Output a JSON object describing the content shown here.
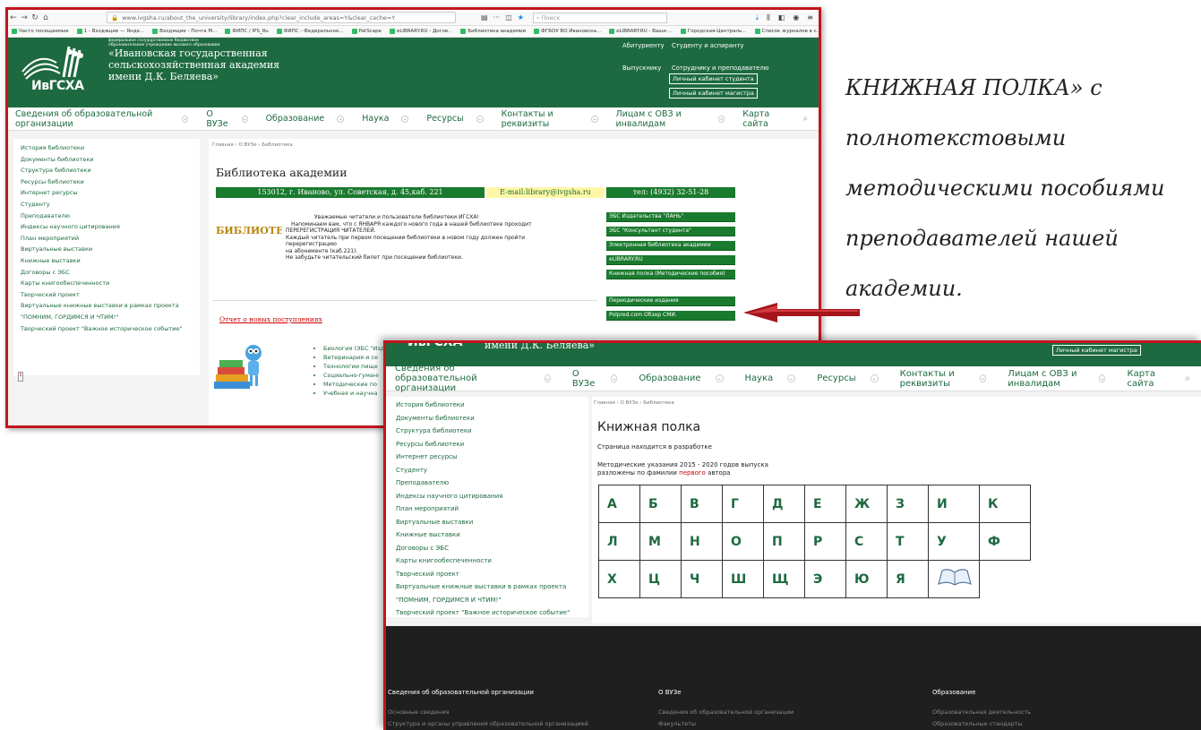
{
  "annotation": {
    "lines": [
      "КНИЖНАЯ ПОЛКА» с",
      "полнотекстовыми",
      "методическими пособиями",
      "преподавателей нашей",
      "академии."
    ]
  },
  "browser": {
    "url": "www.ivgsha.ru/about_the_university/library/index.php?clear_include_areas=Y&clear_cache=Y",
    "search_placeholder": "Поиск",
    "bookmarks": [
      "Часто посещаемые",
      "1 - Входящие — Янде...",
      "Входящие - Почта М...",
      "ФИПС / IPS_Ru",
      "ФИПС - Федеральное...",
      "PatScape",
      "eLIBRARY.RU - Догов...",
      "Библиотека академии",
      "ФГБОУ ВО Ивановска...",
      "eLIBRARY.RU - Ваши ...",
      "Городская-Централь...",
      "Список журналов в с..."
    ]
  },
  "site": {
    "logo_text": "ИвГСХА",
    "inst_small1": "федеральное государственное бюджетное",
    "inst_small2": "образовательное учреждение высшего образования",
    "inst_line1": "«Ивановская государственная",
    "inst_line2": "сельскохозяйственная академия",
    "inst_line3": "имени Д.К. Беляева»",
    "header_links": [
      "Абитуриенту",
      "Студенту и аспиранту",
      "Выпускнику",
      "Сотруднику и преподавателю"
    ],
    "cabinet_student": "Личный кабинет студента",
    "cabinet_master": "Личный кабинет магистра",
    "menu": [
      "Сведения об образовательной организации",
      "О ВУЗе",
      "Образование",
      "Наука",
      "Ресурсы",
      "Контакты и реквизиты",
      "Лицам с ОВЗ и инвалидам",
      "Карта сайта"
    ],
    "sidebar": [
      "История библиотеки",
      "Документы библиотеки",
      "Структура библиотеки",
      "Ресурсы библиотеки",
      "Интернет ресурсы",
      "Студенту",
      "Преподавателю",
      "Индексы научного цитирования",
      "План мероприятий",
      "Виртуальные выставки",
      "Книжные выставки",
      "Договоры с ЭБС",
      "Карты книгообеспеченности",
      "Творческий проект",
      "Виртуальные книжные выставки в рамках проекта \"ПОМНИМ, ГОРДИМСЯ И ЧТИМ!\"",
      "Творческий проект \"Важное историческое событие\""
    ]
  },
  "page1": {
    "breadcrumb": [
      "Главная",
      "О ВУЗе",
      "Библиотека"
    ],
    "title": "Библиотека академии",
    "address": "153012, г. Иваново, ул. Советская, д. 45,каб. 221",
    "email": "E-mail:library@ivgsha.ru",
    "phone": "тел: (4932) 32-51-28",
    "notice_line1": "Уважаемые читатели и пользователи библиотеки ИГСХА!",
    "notice_line2": "Напоминаем вам, что с ЯНВАРЯ каждого нового года в нашей библиотеке проходит",
    "notice_line3": "ПЕРЕРЕГИСТРАЦИЯ ЧИТАТЕЛЕЙ.",
    "notice_line4": "Каждый читатель при первом посещении библиотеки в новом году должен пройти перерегистрацию",
    "notice_line5": "на абонементе (каб.221).",
    "notice_line6": "Не забудьте читательский билет при посещении библиотеки.",
    "right_links": [
      "ЭБС Издательства \"ЛАНЬ\"",
      "ЭБС \"Консультант студента\"",
      "Электронная библиотека академии",
      "eLIBRARY.RU",
      "Книжная полка (Методические пособия)",
      "Периодические издания",
      "Polpred.com Обзор СМИ."
    ],
    "report_link": "Отчет о новых поступлениях",
    "books": [
      "Биология (ЭБС \"Издательство Лань\")",
      "Ветеринария и се",
      "Технологии пище",
      "Социально-гумані",
      "Методические по",
      "Учебная и научна"
    ]
  },
  "page2": {
    "breadcrumb": [
      "Главная",
      "О ВУЗе",
      "Библиотека"
    ],
    "title": "Книжная полка",
    "status": "Страница находится в разработке",
    "desc_line1": "Методические указания 2015 - 2020 годов выпуска",
    "desc_prefix": "разложены по фамилии ",
    "desc_highlight": "первого",
    "desc_suffix": " автора",
    "letters_row1": [
      "А",
      "Б",
      "В",
      "Г",
      "Д",
      "Е",
      "Ж",
      "З",
      "И",
      "К"
    ],
    "letters_row2": [
      "Л",
      "М",
      "Н",
      "О",
      "П",
      "Р",
      "С",
      "Т",
      "У",
      "Ф"
    ],
    "letters_row3": [
      "Х",
      "Ц",
      "Ч",
      "Ш",
      "Щ",
      "Э",
      "Ю",
      "Я"
    ],
    "footer_cols": [
      {
        "title": "Сведения об образовательной организации",
        "links": [
          "Основные сведения",
          "Структура и органы управления образовательной организацией"
        ]
      },
      {
        "title": "О ВУЗе",
        "links": [
          "Сведения об образовательной организации",
          "Факультеты"
        ]
      },
      {
        "title": "Образование",
        "links": [
          "Образовательная деятельность",
          "Образовательные стандарты"
        ]
      }
    ]
  },
  "colors": {
    "accent_green": "#1e6a40",
    "frame_red": "#c2161c",
    "bar_green": "#1a7a2e"
  }
}
